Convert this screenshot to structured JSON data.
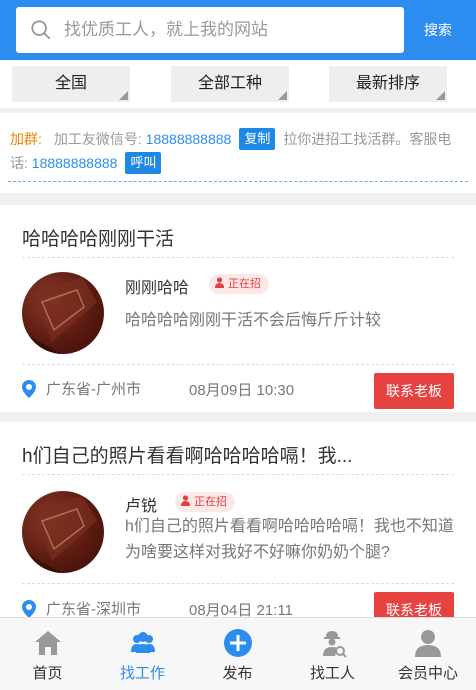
{
  "search": {
    "placeholder": "找优质工人，就上我的网站",
    "button": "搜索"
  },
  "filters": [
    "全国",
    "全部工种",
    "最新排序"
  ],
  "notice": {
    "label": "加群:",
    "text1": "加工友微信号:",
    "wechat": "18888888888",
    "copy_button": "复制",
    "text2": "拉你进招工找活群。客服电话:",
    "service_phone": "18888888888",
    "call_button": "呼叫"
  },
  "posts": [
    {
      "title": "哈哈哈哈刚刚干活",
      "name": "刚刚哈哈",
      "status": "正在招",
      "desc": "哈哈哈哈刚刚干活不会后悔斤斤计较",
      "location": "广东省-广州市",
      "date": "08月09日 10:30",
      "contact": "联系老板"
    },
    {
      "title": "h们自己的照片看看啊哈哈哈哈嗝！我...",
      "name": "卢锐",
      "status": "正在招",
      "desc": "h们自己的照片看看啊哈哈哈哈嗝！我也不知道为啥要这样对我好不好嘛你奶奶个腿?",
      "location": "广东省-深圳市",
      "date": "08月04日 21:11",
      "contact": "联系老板"
    }
  ],
  "tabs": [
    "首页",
    "找工作",
    "发布",
    "找工人",
    "会员中心"
  ],
  "colors": {
    "primary": "#2d8cf0",
    "danger": "#e64340",
    "warning": "#f08300"
  }
}
